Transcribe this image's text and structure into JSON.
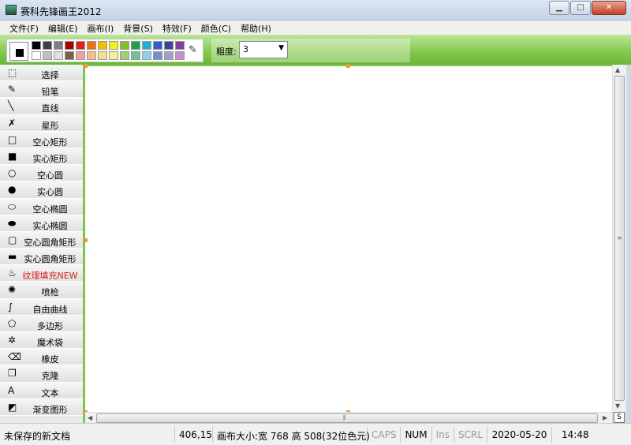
{
  "window": {
    "title": "赛科先锋画王2012",
    "min_label": "▁",
    "max_label": "□",
    "close_label": "✕"
  },
  "menu": [
    {
      "label": "文件(F)"
    },
    {
      "label": "编辑(E)"
    },
    {
      "label": "画布(I)"
    },
    {
      "label": "背景(S)"
    },
    {
      "label": "特效(F)"
    },
    {
      "label": "颜色(C)"
    },
    {
      "label": "帮助(H)"
    }
  ],
  "palette": {
    "current_foreground": "#000000",
    "current_background": "#ffffff",
    "colors": [
      "#000000",
      "#404040",
      "#808080",
      "#a00000",
      "#e02020",
      "#f07010",
      "#f0c000",
      "#f0f020",
      "#80c020",
      "#20a040",
      "#20b0d0",
      "#3060d0",
      "#4040a0",
      "#8040a0",
      "#ffffff",
      "#c0c0c0",
      "#e0e0e0",
      "#806040",
      "#f0a0a0",
      "#f0c090",
      "#f0e090",
      "#f0f0a0",
      "#a0d070",
      "#70c090",
      "#90d0f0",
      "#7090d0",
      "#a0a0d0",
      "#c090d0"
    ]
  },
  "thickness": {
    "label": "粗度:",
    "value": "3"
  },
  "tools": [
    {
      "name": "select",
      "icon": "⬚",
      "label": "选择"
    },
    {
      "name": "pencil",
      "icon": "✎",
      "label": "铅笔"
    },
    {
      "name": "line",
      "icon": "╲",
      "label": "直线"
    },
    {
      "name": "star",
      "icon": "✗",
      "label": "星形"
    },
    {
      "name": "hollow-rect",
      "icon": "□",
      "label": "空心矩形"
    },
    {
      "name": "solid-rect",
      "icon": "■",
      "label": "实心矩形"
    },
    {
      "name": "hollow-circle",
      "icon": "○",
      "label": "空心圆"
    },
    {
      "name": "solid-circle",
      "icon": "●",
      "label": "实心圆"
    },
    {
      "name": "hollow-ellipse",
      "icon": "⬭",
      "label": "空心椭圆"
    },
    {
      "name": "solid-ellipse",
      "icon": "⬬",
      "label": "实心椭圆"
    },
    {
      "name": "hollow-round-rect",
      "icon": "▢",
      "label": "空心圆角矩形"
    },
    {
      "name": "solid-round-rect",
      "icon": "▬",
      "label": "实心圆角矩形"
    },
    {
      "name": "texture-fill",
      "icon": "♨",
      "label": "纹理填充NEW"
    },
    {
      "name": "spray",
      "icon": "✺",
      "label": "喷枪"
    },
    {
      "name": "free-curve",
      "icon": "∫",
      "label": "自由曲线"
    },
    {
      "name": "polygon",
      "icon": "⬠",
      "label": "多边形"
    },
    {
      "name": "magic-bag",
      "icon": "✲",
      "label": "魔术袋"
    },
    {
      "name": "eraser",
      "icon": "⌫",
      "label": "橡皮"
    },
    {
      "name": "clone",
      "icon": "❐",
      "label": "克隆"
    },
    {
      "name": "text",
      "icon": "A",
      "label": "文本"
    },
    {
      "name": "gradient-shape",
      "icon": "◩",
      "label": "渐变图形"
    }
  ],
  "status": {
    "doc": "未保存的新文档",
    "coords": "406,15",
    "canvas_size": "画布大小:宽 768 高 508(32位色元)",
    "caps": "CAPS",
    "num": "NUM",
    "ins": "Ins",
    "scrl": "SCRL",
    "date": "2020-05-20",
    "time": "14:48"
  },
  "scroll": {
    "corner_label": "S"
  }
}
